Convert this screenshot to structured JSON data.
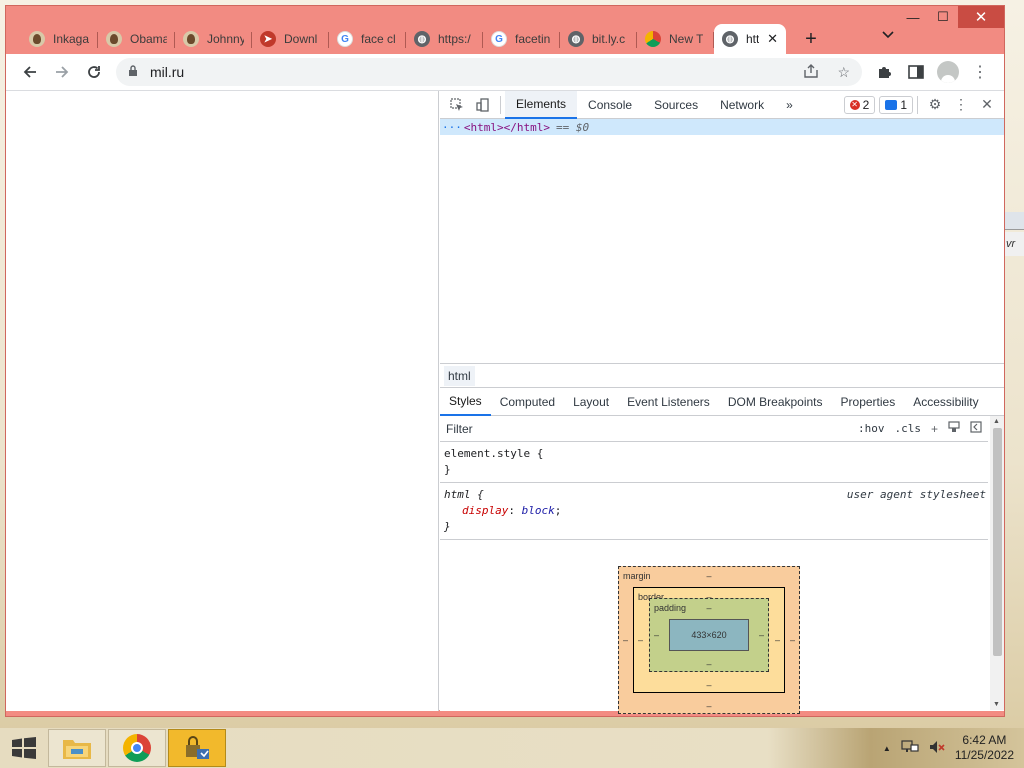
{
  "browser": {
    "tabs": [
      {
        "title": "Inkaga",
        "favicon": "face-icon"
      },
      {
        "title": "Obama",
        "favicon": "face-icon"
      },
      {
        "title": "Johnny",
        "favicon": "face-icon"
      },
      {
        "title": "Downl",
        "favicon": "download-icon"
      },
      {
        "title": "face cl",
        "favicon": "google-icon"
      },
      {
        "title": "https:/",
        "favicon": "globe-icon"
      },
      {
        "title": "facetin",
        "favicon": "google-icon"
      },
      {
        "title": "bit.ly.c",
        "favicon": "globe-icon"
      },
      {
        "title": "New T",
        "favicon": "chrome-icon"
      }
    ],
    "active_tab": {
      "title": "htt",
      "close": "✕"
    },
    "new_tab": "+",
    "url": "mil.ru",
    "caption": {
      "minimize": "—",
      "maximize": "☐",
      "close": "✕"
    }
  },
  "devtools": {
    "tabs": [
      "Elements",
      "Console",
      "Sources",
      "Network"
    ],
    "active_tab": "Elements",
    "more": "»",
    "errors_count": "2",
    "messages_count": "1",
    "dom_row": {
      "ellipsis": "···",
      "tag": "<html></html>",
      "selected": "== $0"
    },
    "breadcrumb": "html",
    "sub_tabs": [
      "Styles",
      "Computed",
      "Layout",
      "Event Listeners",
      "DOM Breakpoints",
      "Properties",
      "Accessibility"
    ],
    "active_sub_tab": "Styles",
    "filter_placeholder": "Filter",
    "filter_buttons": {
      "hov": ":hov",
      "cls": ".cls",
      "add": "+"
    },
    "rules": {
      "element_style": {
        "open": "element.style {",
        "close": "}"
      },
      "html": {
        "open": "html {",
        "source": "user agent stylesheet",
        "prop": "display",
        "colon": ":",
        "value": "block",
        "semicolon": ";",
        "close": "}"
      }
    },
    "box_model": {
      "margin_label": "margin",
      "border_label": "border",
      "padding_label": "padding",
      "content_size": "433×620",
      "dash": "–"
    }
  },
  "taskbar": {
    "time": "6:42 AM",
    "date": "11/25/2022",
    "tray_up": "▲"
  }
}
